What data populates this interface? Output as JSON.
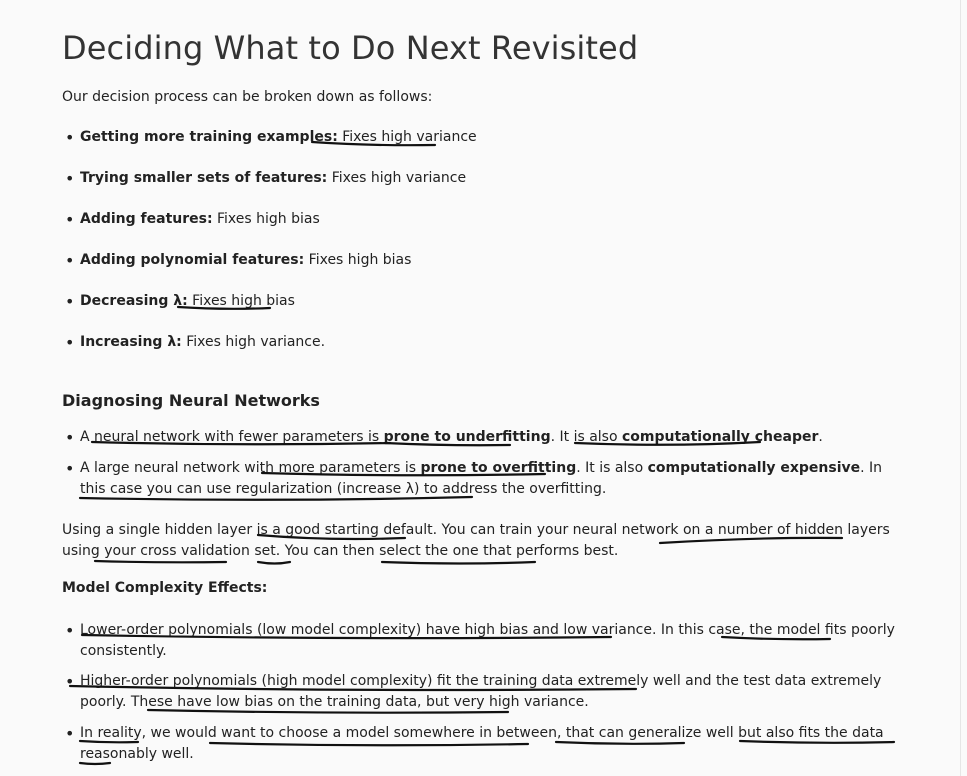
{
  "title": "Deciding What to Do Next Revisited",
  "intro": "Our decision process can be broken down as follows:",
  "decision_items": [
    {
      "bold": "Getting more training examples:",
      "text": " Fixes high variance"
    },
    {
      "bold": "Trying smaller sets of features:",
      "text": " Fixes high variance"
    },
    {
      "bold": "Adding features:",
      "text": " Fixes high bias"
    },
    {
      "bold": "Adding polynomial features:",
      "text": " Fixes high bias"
    },
    {
      "bold": "Decreasing λ:",
      "text": " Fixes high bias"
    },
    {
      "bold": "Increasing λ:",
      "text": " Fixes high variance."
    }
  ],
  "nn_heading": "Diagnosing Neural Networks",
  "nn_items": [
    {
      "p1": "A neural network with fewer parameters is ",
      "b1": "prone to underfitting",
      "p2": ". It is also ",
      "b2": "computationally cheaper",
      "p3": "."
    },
    {
      "p1": "A large neural network with more parameters is ",
      "b1": "prone to overfitting",
      "p2": ". It is also ",
      "b2": "computationally expensive",
      "p3": ". In this case you can use regularization (increase λ) to address the overfitting."
    }
  ],
  "paragraph": "Using a single hidden layer is a good starting default. You can train your neural network on a number of hidden layers using your cross validation set. You can then select the one that performs best.",
  "complexity_heading": "Model Complexity Effects:",
  "complexity_items": [
    "Lower-order polynomials (low model complexity) have high bias and low variance. In this case, the model fits poorly consistently.",
    "Higher-order polynomials (high model complexity) fit the training data extremely well and the test data extremely poorly. These have low bias on the training data, but very high variance.",
    "In reality, we would want to choose a model somewhere in between, that can generalize well but also fits the data reasonably well."
  ]
}
